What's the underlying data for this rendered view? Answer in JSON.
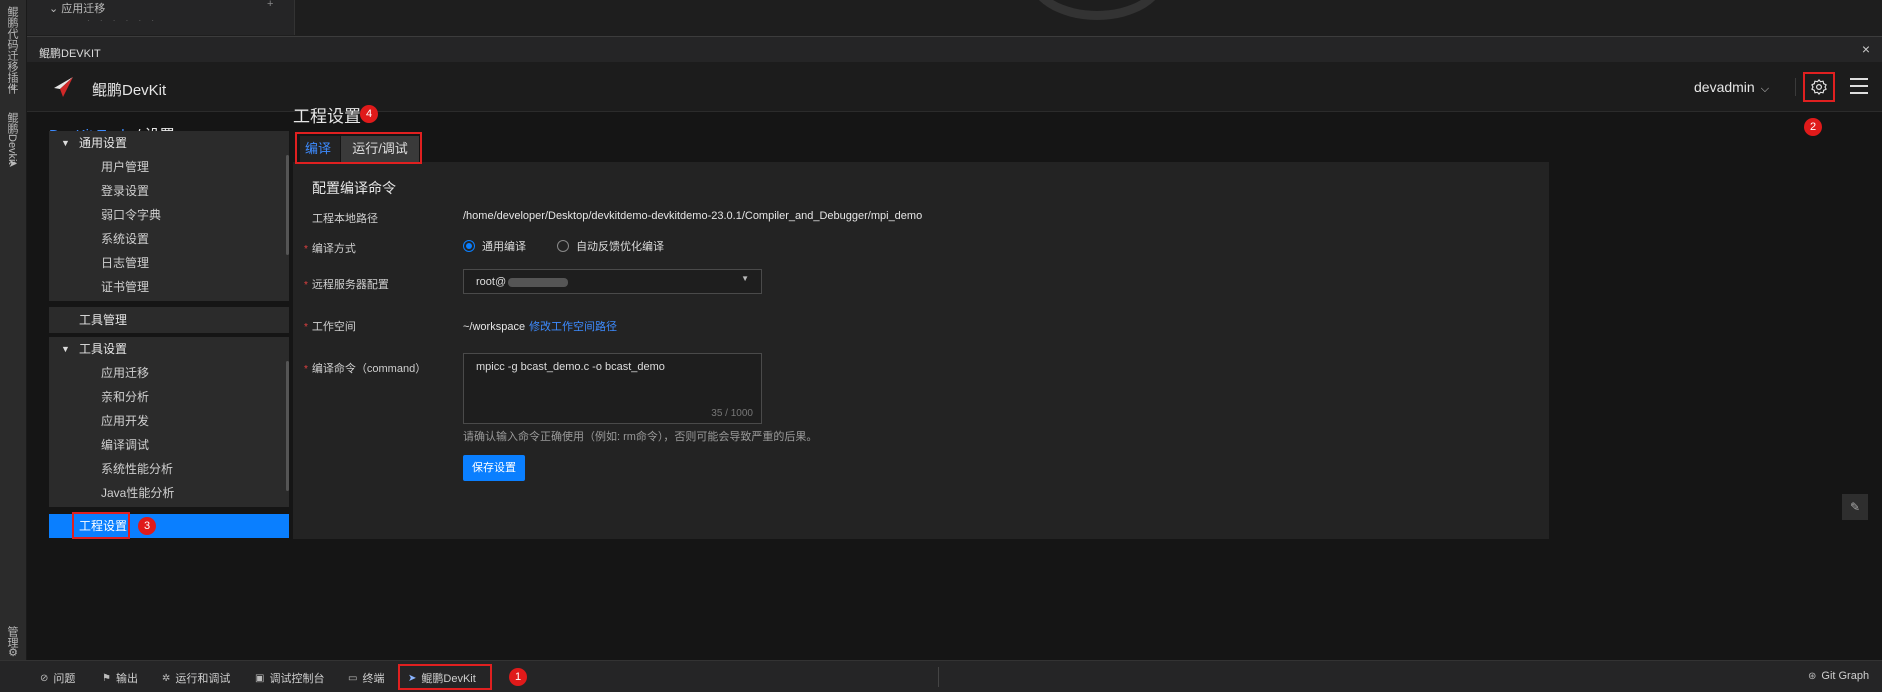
{
  "activity": {
    "plugin_label": "鲲鹏代码迁移插件",
    "devkit_label": "鲲鹏Devkit",
    "manage_label": "管理"
  },
  "explorer_peek": {
    "row_label": "应用迁移",
    "new_file_glyph": "+"
  },
  "panel": {
    "title": "鲲鹏DEVKIT",
    "close": "×"
  },
  "topbar": {
    "brand": "鲲鹏DevKit",
    "user": "devadmin",
    "user_chevron": "⌵"
  },
  "breadcrumb": {
    "root": "DevKit Tools",
    "sep": " / ",
    "current": "设置"
  },
  "sidebar": {
    "general": {
      "header": "通用设置",
      "items": [
        "用户管理",
        "登录设置",
        "弱口令字典",
        "系统设置",
        "日志管理",
        "证书管理"
      ]
    },
    "tool_mgmt": "工具管理",
    "tool_settings": {
      "header": "工具设置",
      "items": [
        "应用迁移",
        "亲和分析",
        "应用开发",
        "编译调试",
        "系统性能分析",
        "Java性能分析"
      ]
    },
    "project_settings": "工程设置"
  },
  "main": {
    "title": "工程设置",
    "tabs": [
      "编译",
      "运行/调试"
    ],
    "section_title": "配置编译命令",
    "fields": {
      "path_label": "工程本地路径",
      "path_value": "/home/developer/Desktop/devkitdemo-devkitdemo-23.0.1/Compiler_and_Debugger/mpi_demo",
      "mode_label": "编译方式",
      "mode_options": [
        "通用编译",
        "自动反馈优化编译"
      ],
      "server_label": "远程服务器配置",
      "server_value": "root@",
      "workspace_label": "工作空间",
      "workspace_value": "~/workspace",
      "workspace_link": "修改工作空间路径",
      "command_label": "编译命令（command）",
      "command_value": "mpicc -g bcast_demo.c -o bcast_demo",
      "command_count": "35 / 1000",
      "hint": "请确认输入命令正确使用（例如: rm命令），否则可能会导致严重的后果。",
      "required_mark": "*"
    },
    "save_button": "保存设置"
  },
  "badges": [
    "1",
    "2",
    "3",
    "4"
  ],
  "statusbar": {
    "items": [
      "问题",
      "输出",
      "运行和调试",
      "调试控制台",
      "终端",
      "鲲鹏DevKit"
    ],
    "right": "Git Graph"
  },
  "colors": {
    "accent": "#0a7fff",
    "highlight_box": "#e02020",
    "badge": "#e01a1a"
  }
}
